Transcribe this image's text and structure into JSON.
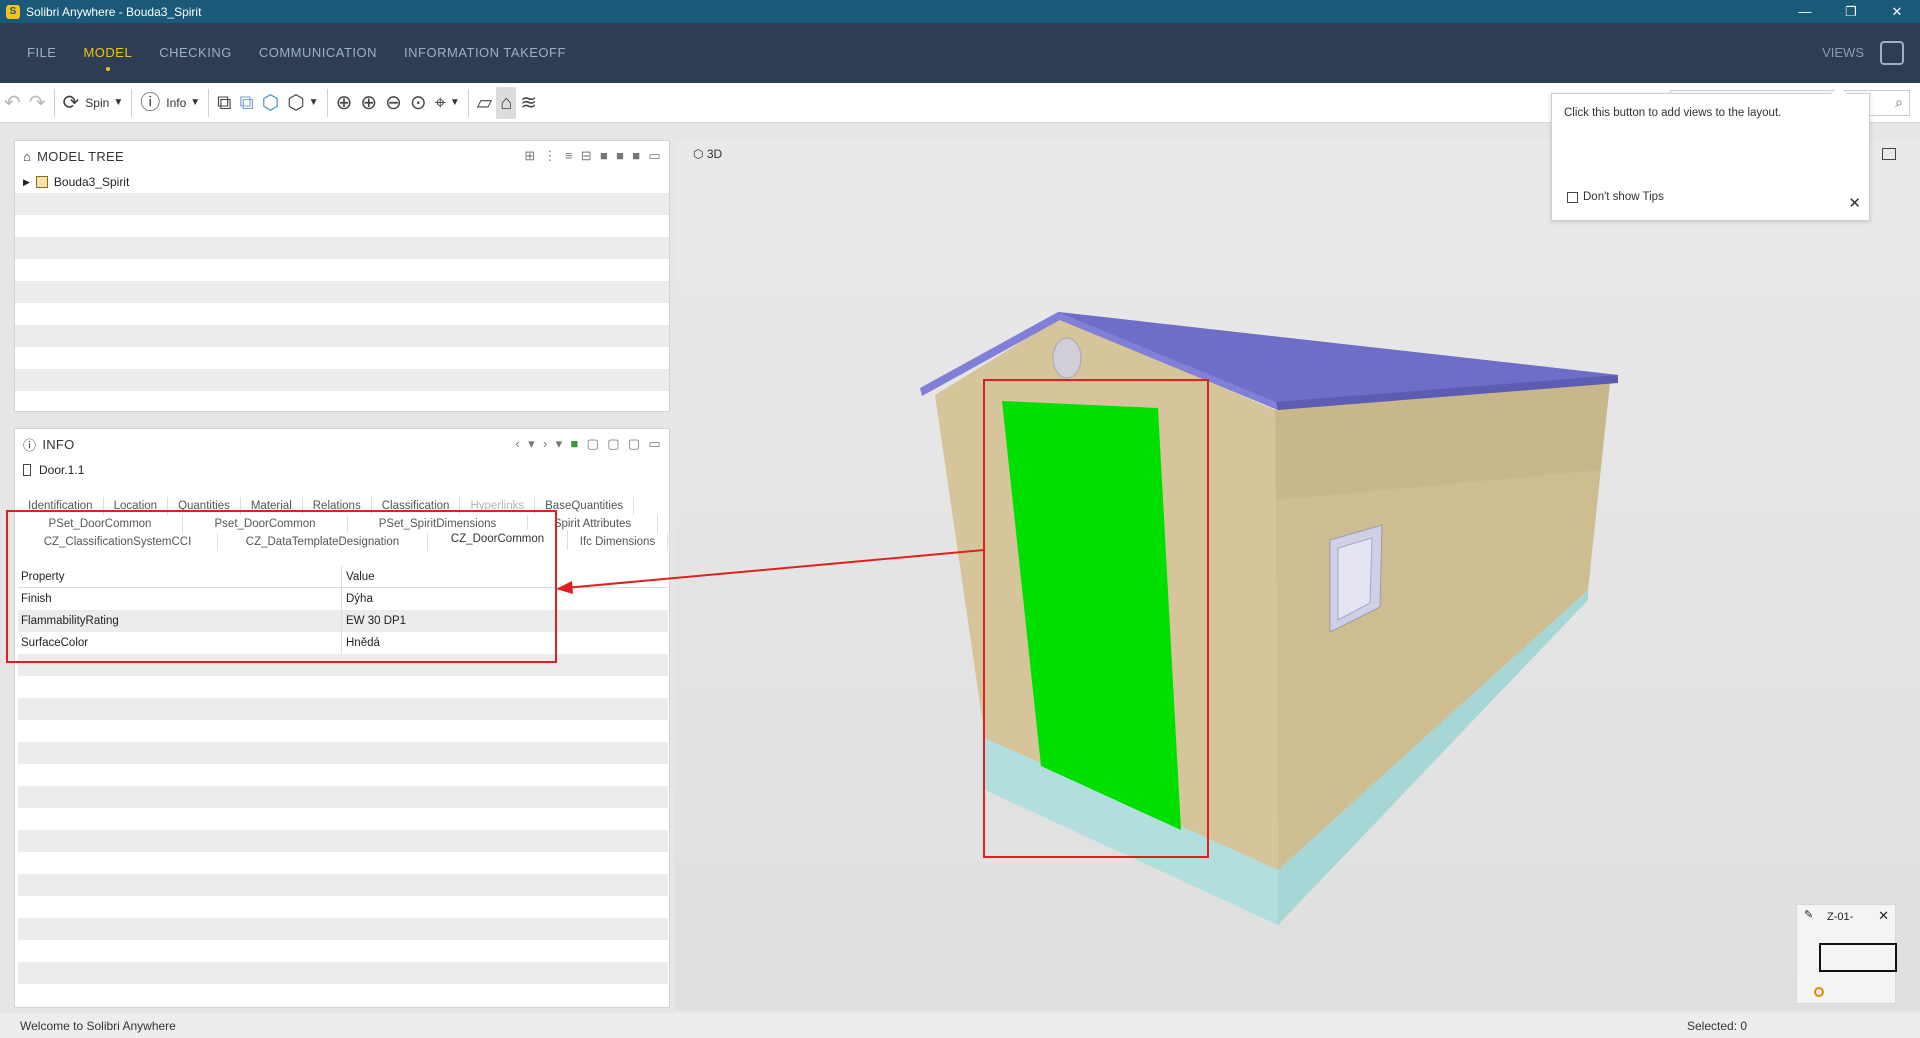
{
  "window": {
    "title": "Solibri Anywhere - Bouda3_Spirit",
    "logo_letter": "S",
    "minimize": "—",
    "restore": "❐",
    "close": "✕"
  },
  "menu": {
    "items": [
      "FILE",
      "MODEL",
      "CHECKING",
      "COMMUNICATION",
      "INFORMATION TAKEOFF"
    ],
    "active": "MODEL",
    "views_label": "VIEWS"
  },
  "toolbar": {
    "spin_label": "Spin",
    "info_label": "Info"
  },
  "model_tree": {
    "title": "MODEL TREE",
    "root": "Bouda3_Spirit"
  },
  "info_panel": {
    "title": "INFO",
    "object": "Door.1.1",
    "tabs_row1": [
      "Identification",
      "Location",
      "Quantities",
      "Material",
      "Relations",
      "Classification",
      "Hyperlinks",
      "BaseQuantities"
    ],
    "tabs_row2": [
      "PSet_DoorCommon",
      "Pset_DoorCommon",
      "PSet_SpiritDimensions",
      "Spirit Attributes"
    ],
    "tabs_row3": [
      "CZ_ClassificationSystemCCI",
      "CZ_DataTemplateDesignation",
      "CZ_DoorCommon",
      "Ifc Dimensions"
    ],
    "active_tab": "CZ_DoorCommon",
    "table_headers": [
      "Property",
      "Value"
    ],
    "rows": [
      [
        "Finish",
        "Dýha"
      ],
      [
        "FlammabilityRating",
        "EW 30 DP1"
      ],
      [
        "SurfaceColor",
        "Hnědá"
      ]
    ]
  },
  "view3d": {
    "label": "3D"
  },
  "tooltip": {
    "message": "Click this button to add views to the layout.",
    "checkbox_label": "Don't show Tips"
  },
  "minimap": {
    "floor_label": "Z-01-"
  },
  "statusbar": {
    "left": "Welcome to Solibri Anywhere",
    "right": "Selected: 0"
  },
  "colors": {
    "titlebar": "#1a5a78",
    "menubar": "#2d3e52",
    "accent": "#f2c21b",
    "door_highlight": "#00e000",
    "annotation_red": "#e02020",
    "roof": "#6e6ec8",
    "walls": "#d9c9a0",
    "foundation": "#a6d6d6"
  }
}
